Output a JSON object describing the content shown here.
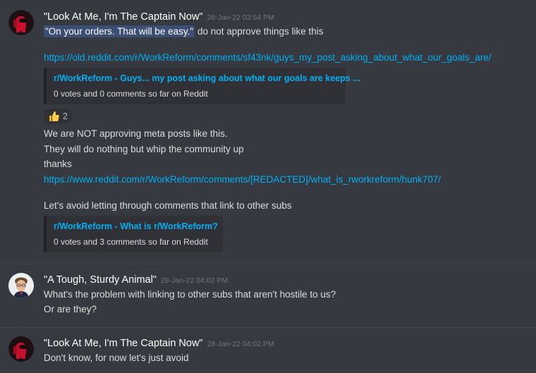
{
  "messages": [
    {
      "author": "\"Look At Me, I'm The Captain Now\"",
      "timestamp": "28-Jan-22 03:54 PM",
      "highlight": "\"On your orders. That will be easy.\"",
      "text_after_highlight": " do not approve things like this",
      "link1": "https://old.reddit.com/r/WorkReform/comments/sf43nk/guys_my_post_asking_about_what_our_goals_are/",
      "embed1": {
        "title": "r/WorkReform - Guys... my post asking about what our goals are keeps ...",
        "desc": "0 votes and 0 comments so far on Reddit"
      },
      "reaction": {
        "emoji": "thumbs-up",
        "count": "2"
      },
      "text2": "We are NOT approving meta posts like this.",
      "text3": "They will do nothing but whip the community up",
      "text4": "thanks",
      "link2": "https://www.reddit.com/r/WorkReform/comments/[REDACTED]/what_is_rworkreform/hunk707/",
      "text5": "Let's avoid letting through comments that link to other subs",
      "embed2": {
        "title": "r/WorkReform - What is r/WorkReform?",
        "desc": "0 votes and 3 comments so far on Reddit"
      }
    },
    {
      "author": "\"A Tough, Sturdy Animal\"",
      "timestamp": "28-Jan-22 04:02 PM",
      "line1": "What's the problem with linking to other subs that aren't hostile to us?",
      "line2": "Or are they?"
    },
    {
      "author": "\"Look At Me, I'm The Captain Now\"",
      "timestamp": "28-Jan-22 04:02 PM",
      "line1": "Don't know, for now let's just avoid"
    }
  ]
}
